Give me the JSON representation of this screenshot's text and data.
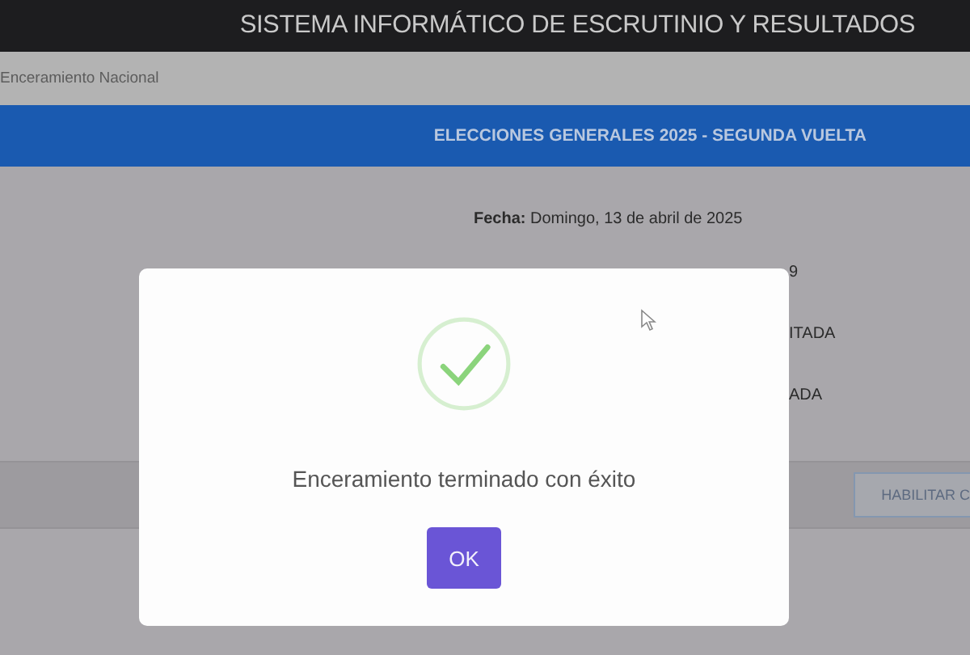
{
  "header": {
    "title": "SISTEMA INFORMÁTICO DE ESCRUTINIO Y RESULTADOS"
  },
  "breadcrumb": {
    "text": "Enceramiento Nacional"
  },
  "banner": {
    "title": "ELECCIONES GENERALES 2025 - SEGUNDA VUELTA"
  },
  "details": {
    "date_line": "**Fecha:** Domingo, 13 de abril de 2025",
    "cut_lines": [
      "9",
      "ITADA",
      "ADA"
    ]
  },
  "action_bar": {
    "button": "HABILITAR C"
  },
  "dialog": {
    "message": "Enceramiento terminado con éxito",
    "button": "OK"
  }
}
